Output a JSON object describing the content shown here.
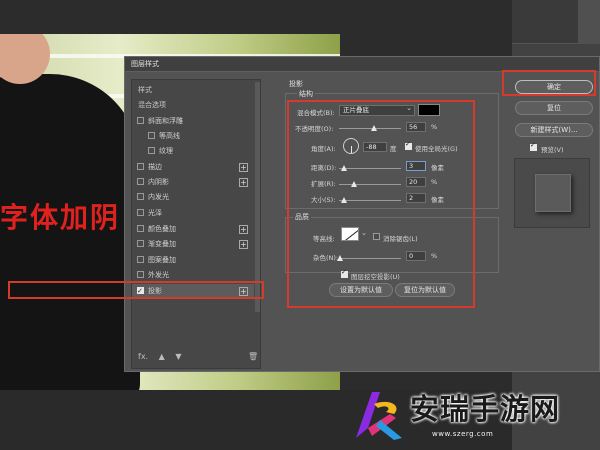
{
  "canvas": {
    "overlay_text": "字体加阴"
  },
  "dialog": {
    "title": "图层样式",
    "style_list": {
      "header_styles": "样式",
      "header_blend": "混合选项",
      "items": [
        {
          "label": "斜面和浮雕",
          "checked": false,
          "plus": false,
          "sub": false
        },
        {
          "label": "等高线",
          "checked": false,
          "plus": false,
          "sub": true
        },
        {
          "label": "纹理",
          "checked": false,
          "plus": false,
          "sub": true
        },
        {
          "label": "描边",
          "checked": false,
          "plus": true,
          "sub": false
        },
        {
          "label": "内阴影",
          "checked": false,
          "plus": true,
          "sub": false
        },
        {
          "label": "内发光",
          "checked": false,
          "plus": false,
          "sub": false
        },
        {
          "label": "光泽",
          "checked": false,
          "plus": false,
          "sub": false
        },
        {
          "label": "颜色叠加",
          "checked": false,
          "plus": true,
          "sub": false
        },
        {
          "label": "渐变叠加",
          "checked": false,
          "plus": true,
          "sub": false
        },
        {
          "label": "图案叠加",
          "checked": false,
          "plus": false,
          "sub": false
        },
        {
          "label": "外发光",
          "checked": false,
          "plus": false,
          "sub": false
        },
        {
          "label": "投影",
          "checked": true,
          "plus": true,
          "sub": false
        }
      ],
      "footer_fx": "fx."
    },
    "panel": {
      "title": "投影",
      "structure": {
        "title": "结构",
        "blend_mode_label": "混合模式(B):",
        "blend_mode_value": "正片叠底",
        "shadow_color": "#000000",
        "opacity_label": "不透明度(O):",
        "opacity_value": "56",
        "opacity_unit": "%",
        "angle_label": "角度(A):",
        "angle_value": "-88",
        "angle_unit": "度",
        "global_light_label": "使用全局光(G)",
        "global_light_checked": true,
        "distance_label": "距离(D):",
        "distance_value": "3",
        "distance_unit": "像素",
        "spread_label": "扩展(R):",
        "spread_value": "20",
        "spread_unit": "%",
        "size_label": "大小(S):",
        "size_value": "2",
        "size_unit": "像素"
      },
      "quality": {
        "title": "品质",
        "contour_label": "等高线:",
        "anti_alias_label": "消除锯齿(L)",
        "anti_alias_checked": false,
        "noise_label": "杂色(N):",
        "noise_value": "0",
        "noise_unit": "%"
      },
      "knockout_label": "图层挖空投影(U)",
      "knockout_checked": true,
      "make_default_label": "设置为默认值",
      "reset_default_label": "复位为默认值"
    },
    "buttons": {
      "ok": "确定",
      "reset": "复位",
      "new_style": "新建样式(W)...",
      "preview_label": "预览(V)",
      "preview_checked": true
    }
  },
  "watermark": {
    "name": "安瑞手游网",
    "url": "www.szerg.com"
  },
  "colors": {
    "highlight": "#d63a2a",
    "canvas_text": "#e0221e"
  }
}
